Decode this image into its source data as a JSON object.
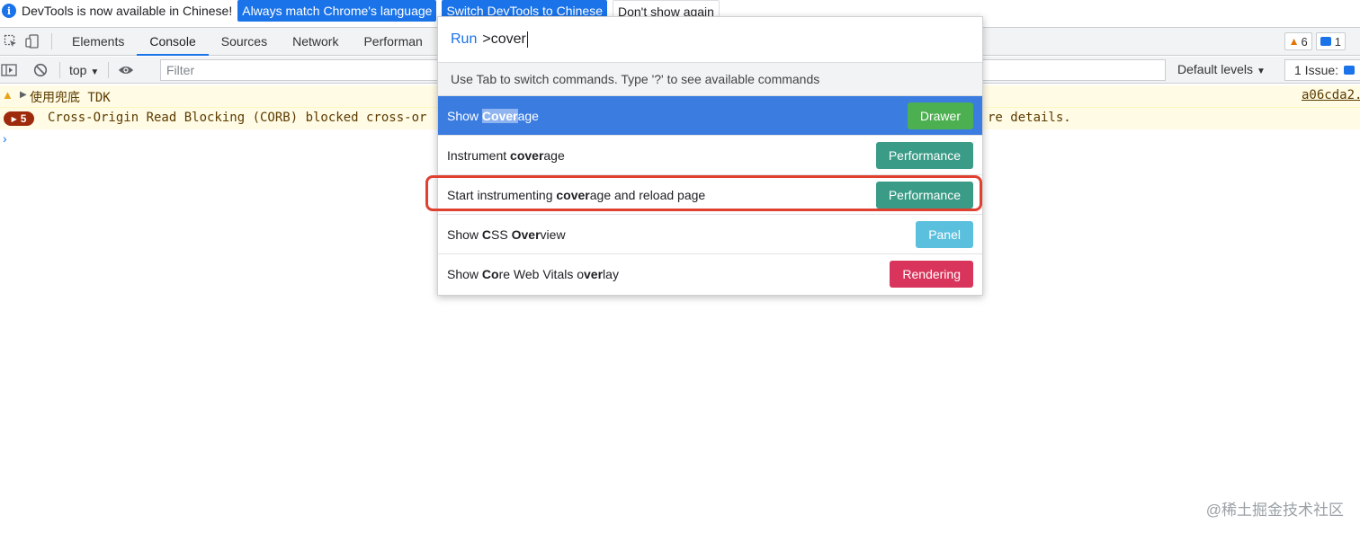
{
  "infobar": {
    "message": "DevTools is now available in Chinese!",
    "btn_match": "Always match Chrome's language",
    "btn_switch": "Switch DevTools to Chinese",
    "btn_dismiss": "Don't show again"
  },
  "tabs": [
    "Elements",
    "Console",
    "Sources",
    "Network",
    "Performan"
  ],
  "active_tab": "Console",
  "counters": {
    "warnings": "6",
    "messages": "1"
  },
  "console_toolbar": {
    "context": "top",
    "filter_placeholder": "Filter",
    "levels": "Default levels",
    "issues": "1 Issue:"
  },
  "console": {
    "warn_text": "使用兜底 TDK",
    "warn_link": "a06cda2.",
    "err_count": "5",
    "err_text": "Cross-Origin Read Blocking (CORB) blocked cross-or",
    "err_tail": "re details."
  },
  "command_menu": {
    "run_label": "Run",
    "query": ">cover",
    "hint": "Use Tab to switch commands. Type '?' to see available commands",
    "items": [
      {
        "pre": "Show ",
        "bold": "Cover",
        "post": "age",
        "tag": "Drawer",
        "tag_color": "#4caf50"
      },
      {
        "pre": "Instrument ",
        "bold": "cover",
        "post": "age",
        "tag": "Performance",
        "tag_color": "#3a9b86"
      },
      {
        "pre": "Start instrumenting ",
        "bold": "cover",
        "post": "age and reload page",
        "tag": "Performance",
        "tag_color": "#3a9b86"
      },
      {
        "pre": "Show ",
        "bold": "C",
        "mid": "SS ",
        "bold2": "Over",
        "post": "view",
        "tag": "Panel",
        "tag_color": "#5bc0de"
      },
      {
        "pre": "Show ",
        "bold": "Co",
        "mid": "re Web Vitals o",
        "bold2": "ver",
        "post": "lay",
        "tag": "Rendering",
        "tag_color": "#d9345b"
      }
    ]
  },
  "watermark": "@稀土掘金技术社区"
}
